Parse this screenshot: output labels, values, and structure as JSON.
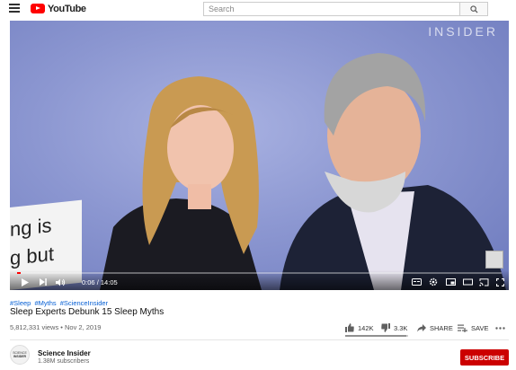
{
  "header": {
    "logo_text": "YouTube",
    "search_placeholder": "Search"
  },
  "player": {
    "watermark": "INSIDER",
    "overlay_text_line1": "ng is",
    "overlay_text_line2": "g but",
    "current_time": "0:06",
    "duration": "14:05",
    "time_separator": "/",
    "progress": 0.007
  },
  "video": {
    "hashtags": [
      "#Sleep",
      "#Myths",
      "#ScienceInsider"
    ],
    "title": "Sleep Experts Debunk 15 Sleep Myths",
    "views_date": "5,812,331 views • Nov 2, 2019",
    "likes": "142K",
    "dislikes": "3.3K",
    "share_label": "SHARE",
    "save_label": "SAVE",
    "like_ratio": 0.977
  },
  "channel": {
    "name": "Science Insider",
    "subscribers": "1.38M subscribers",
    "avatar_text_1": "SCIENCE",
    "avatar_text_2": "INSIDER",
    "subscribe_label": "SUBSCRIBE"
  },
  "colors": {
    "brand_red": "#ff0000",
    "subscribe_red": "#cc0000",
    "link_blue": "#065fd4"
  }
}
